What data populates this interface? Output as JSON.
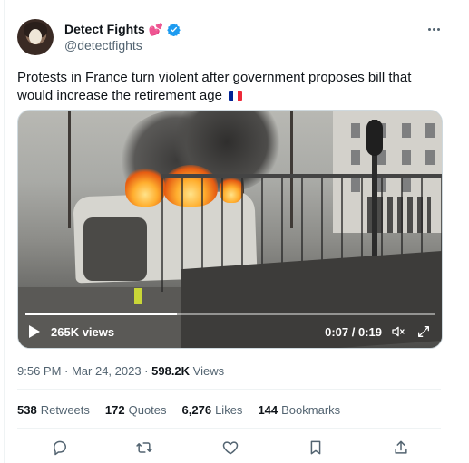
{
  "author": {
    "display_name": "Detect Fights",
    "handle": "@detectfights",
    "badge_emoji_icon": "two-hearts-icon",
    "verified_icon": "verified-badge-icon",
    "verified_color": "#1d9bf0"
  },
  "tweet": {
    "text": "Protests in France turn violent after government proposes bill that would increase the retirement age",
    "flag_icon": "france-flag-icon",
    "flag_colors": [
      "#002395",
      "#ffffff",
      "#ed2939"
    ]
  },
  "video": {
    "views": "265K views",
    "time": "0:07 / 0:19",
    "progress": 0.37
  },
  "meta": {
    "timestamp": "9:56 PM · Mar 24, 2023 · ",
    "views_count": "598.2K",
    "views_label": " Views"
  },
  "stats": {
    "retweets_count": "538",
    "retweets_label": "Retweets",
    "quotes_count": "172",
    "quotes_label": "Quotes",
    "likes_count": "6,276",
    "likes_label": "Likes",
    "bookmarks_count": "144",
    "bookmarks_label": "Bookmarks"
  },
  "actions": [
    "reply-icon",
    "retweet-icon",
    "like-icon",
    "bookmark-icon",
    "share-icon"
  ],
  "colors": {
    "text": "#0f1419",
    "secondary": "#536471",
    "border": "#eff3f4"
  }
}
